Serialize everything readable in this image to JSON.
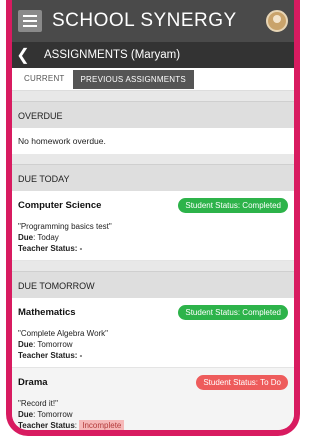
{
  "app": {
    "title": "SCHOOL SYNERGY",
    "page_title": "ASSIGNMENTS (Maryam)"
  },
  "tabs": [
    {
      "label": "CURRENT"
    },
    {
      "label": "PREVIOUS ASSIGNMENTS"
    }
  ],
  "overdue": {
    "header": "OVERDUE",
    "message": "No homework overdue."
  },
  "due_today": {
    "header": "DUE TODAY",
    "items": [
      {
        "subject": "Computer Science",
        "student_status": "Student Status: Completed",
        "assignment": "\"Programming basics test\"",
        "due_label": "Due",
        "due_value": ": Today",
        "teacher_label": "Teacher Status",
        "teacher_value": ": -"
      }
    ]
  },
  "due_tomorrow": {
    "header": "DUE TOMORROW",
    "items": [
      {
        "subject": "Mathematics",
        "student_status": "Student Status: Completed",
        "assignment": "\"Complete Algebra Work\"",
        "due_label": "Due",
        "due_value": ": Tomorrow",
        "teacher_label": "Teacher Status",
        "teacher_value": ": -"
      },
      {
        "subject": "Drama",
        "student_status": "Student Status: To Do",
        "assignment": "\"Record it!\"",
        "due_label": "Due",
        "due_value": ": Tomorrow",
        "teacher_label": "Teacher Status",
        "teacher_value": ":",
        "teacher_badge": "Incomplete"
      }
    ]
  },
  "colors": {
    "frame": "#d81b60",
    "topbar": "#4a4a4a",
    "completed": "#2db34a",
    "todo": "#ee5c5c"
  },
  "icons": [
    "menu-icon",
    "avatar-icon",
    "back-arrow-icon"
  ]
}
